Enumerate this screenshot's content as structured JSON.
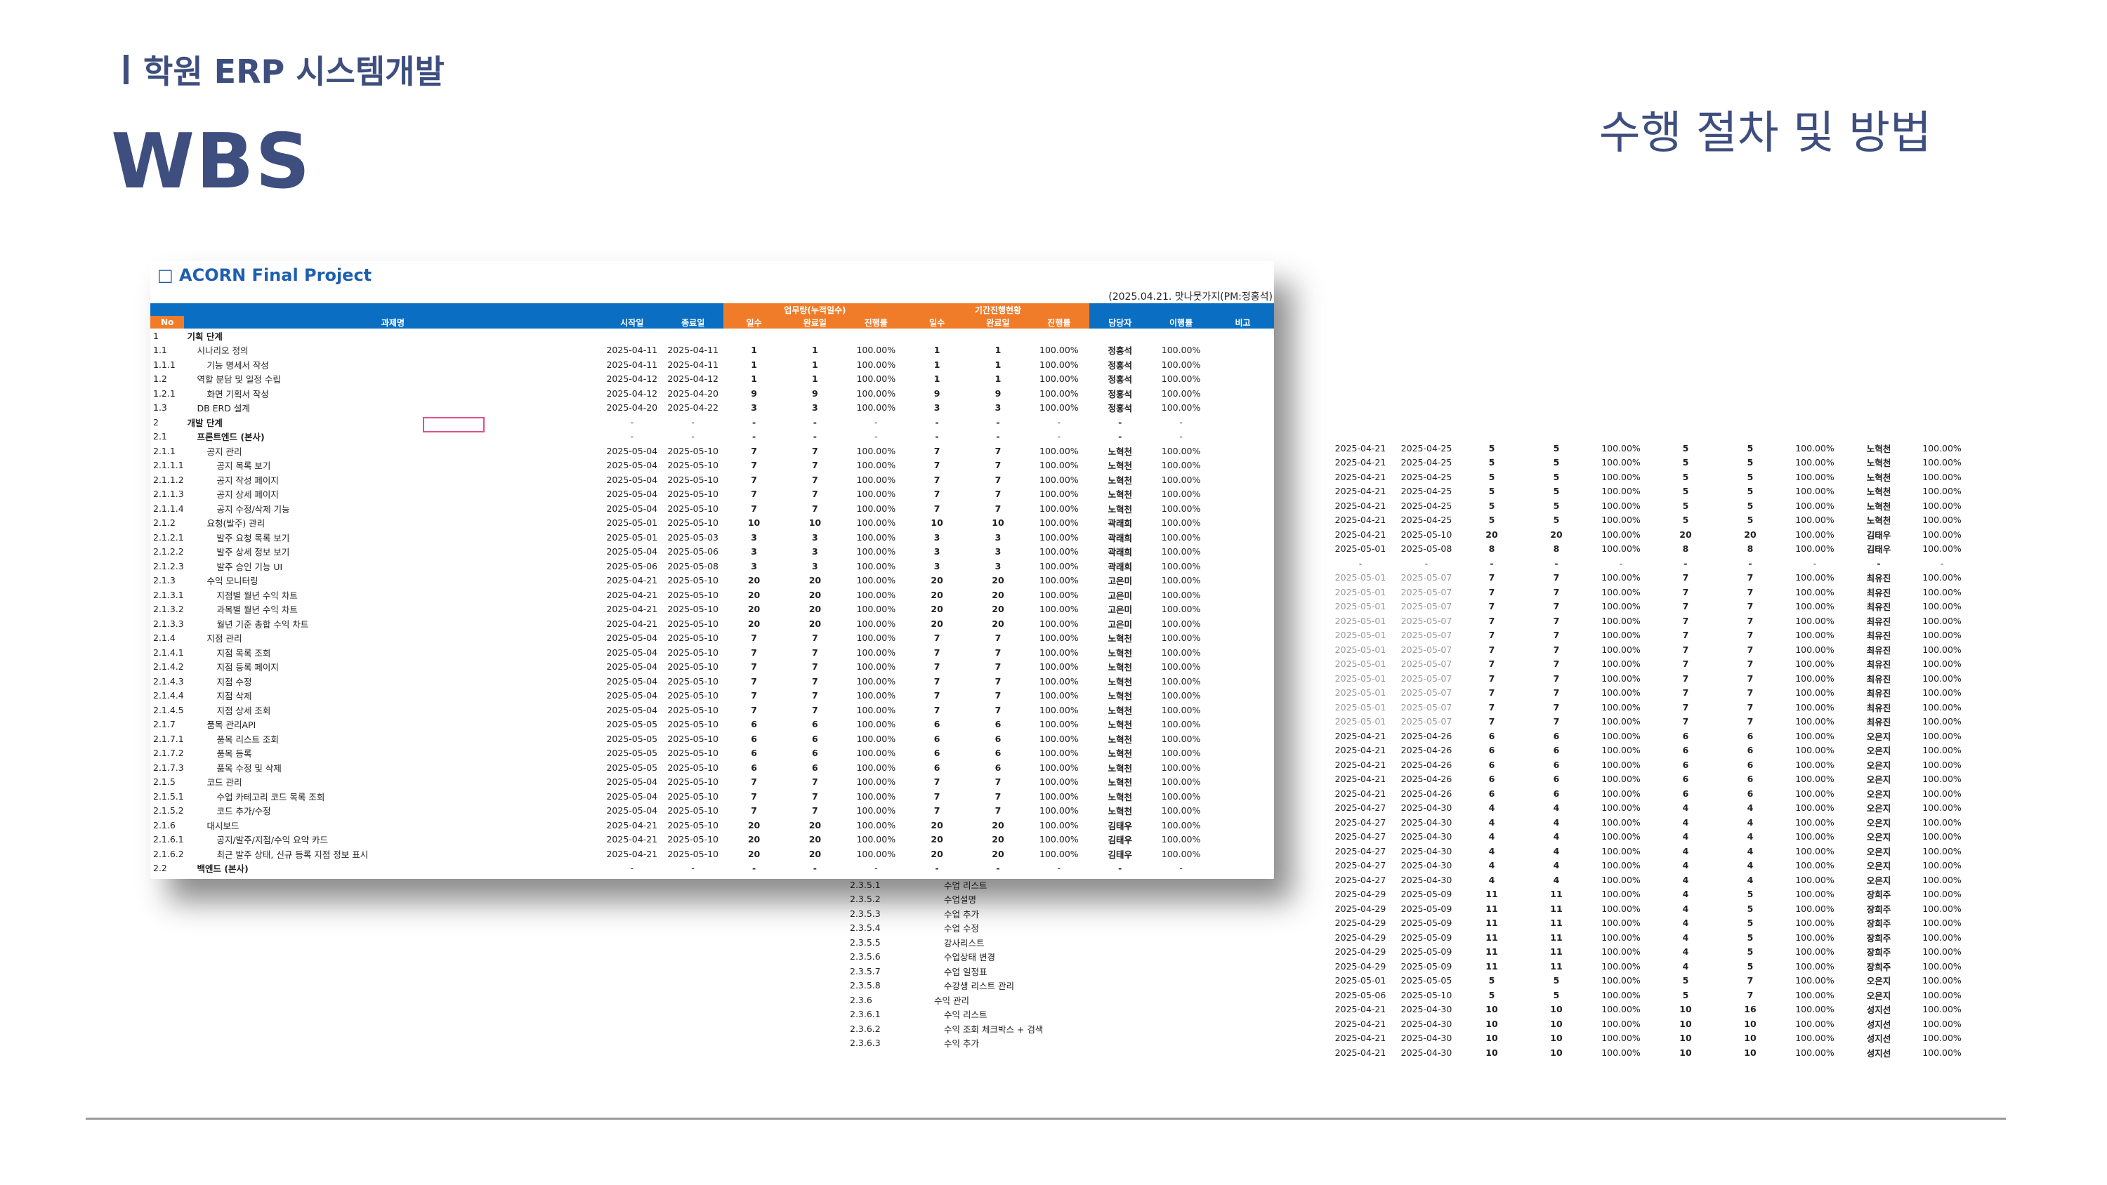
{
  "header": {
    "subtitle": "학원 ERP 시스템개발",
    "title": "WBS",
    "section": "수행 절차 및 방법"
  },
  "sheet": {
    "project_title": "ACORN Final Project",
    "note": "(2025.04.21. 맛나뭇가지(PM:정홍석)",
    "group_headers": {
      "work": "업무량(누적일수)",
      "period": "기간진행현황"
    },
    "columns": [
      "No",
      "과제명",
      "시작일",
      "종료일",
      "일수",
      "완료일",
      "진행률",
      "일수",
      "완료일",
      "진행률",
      "담당자",
      "이행률",
      "비고"
    ],
    "rows": [
      [
        "1",
        "기획 단계",
        "",
        "",
        "",
        "",
        "",
        "",
        "",
        "",
        "",
        "",
        ""
      ],
      [
        "1.1",
        "시나리오 정의",
        "2025-04-11",
        "2025-04-11",
        "1",
        "1",
        "100.00%",
        "1",
        "1",
        "100.00%",
        "정홍석",
        "100.00%",
        ""
      ],
      [
        "1.1.1",
        "기능 명세서 작성",
        "2025-04-11",
        "2025-04-11",
        "1",
        "1",
        "100.00%",
        "1",
        "1",
        "100.00%",
        "정홍석",
        "100.00%",
        ""
      ],
      [
        "1.2",
        "역할 분담 및 일정 수립",
        "2025-04-12",
        "2025-04-12",
        "1",
        "1",
        "100.00%",
        "1",
        "1",
        "100.00%",
        "정홍석",
        "100.00%",
        ""
      ],
      [
        "1.2.1",
        "화면 기획서 작성",
        "2025-04-12",
        "2025-04-20",
        "9",
        "9",
        "100.00%",
        "9",
        "9",
        "100.00%",
        "정홍석",
        "100.00%",
        ""
      ],
      [
        "1.3",
        "DB ERD 설계",
        "2025-04-20",
        "2025-04-22",
        "3",
        "3",
        "100.00%",
        "3",
        "3",
        "100.00%",
        "정홍석",
        "100.00%",
        ""
      ],
      [
        "2",
        "개발 단계",
        "-",
        "-",
        "-",
        "-",
        "-",
        "-",
        "-",
        "-",
        "-",
        "-",
        ""
      ],
      [
        "2.1",
        "프론트엔드 (본사)",
        "-",
        "-",
        "-",
        "-",
        "-",
        "-",
        "-",
        "-",
        "-",
        "-",
        ""
      ],
      [
        "2.1.1",
        "공지 관리",
        "2025-05-04",
        "2025-05-10",
        "7",
        "7",
        "100.00%",
        "7",
        "7",
        "100.00%",
        "노혁천",
        "100.00%",
        ""
      ],
      [
        "2.1.1.1",
        "공지 목록 보기",
        "2025-05-04",
        "2025-05-10",
        "7",
        "7",
        "100.00%",
        "7",
        "7",
        "100.00%",
        "노혁천",
        "100.00%",
        ""
      ],
      [
        "2.1.1.2",
        "공지 작성 페이지",
        "2025-05-04",
        "2025-05-10",
        "7",
        "7",
        "100.00%",
        "7",
        "7",
        "100.00%",
        "노혁천",
        "100.00%",
        ""
      ],
      [
        "2.1.1.3",
        "공지 상세 페이지",
        "2025-05-04",
        "2025-05-10",
        "7",
        "7",
        "100.00%",
        "7",
        "7",
        "100.00%",
        "노혁천",
        "100.00%",
        ""
      ],
      [
        "2.1.1.4",
        "공지 수정/삭제 기능",
        "2025-05-04",
        "2025-05-10",
        "7",
        "7",
        "100.00%",
        "7",
        "7",
        "100.00%",
        "노혁천",
        "100.00%",
        ""
      ],
      [
        "2.1.2",
        "요청(발주) 관리",
        "2025-05-01",
        "2025-05-10",
        "10",
        "10",
        "100.00%",
        "10",
        "10",
        "100.00%",
        "곽래희",
        "100.00%",
        ""
      ],
      [
        "2.1.2.1",
        "발주 요청 목록 보기",
        "2025-05-01",
        "2025-05-03",
        "3",
        "3",
        "100.00%",
        "3",
        "3",
        "100.00%",
        "곽래희",
        "100.00%",
        ""
      ],
      [
        "2.1.2.2",
        "발주 상세 정보 보기",
        "2025-05-04",
        "2025-05-06",
        "3",
        "3",
        "100.00%",
        "3",
        "3",
        "100.00%",
        "곽래희",
        "100.00%",
        ""
      ],
      [
        "2.1.2.3",
        "발주 승인 기능 UI",
        "2025-05-06",
        "2025-05-08",
        "3",
        "3",
        "100.00%",
        "3",
        "3",
        "100.00%",
        "곽래희",
        "100.00%",
        ""
      ],
      [
        "2.1.3",
        "수익 모니터링",
        "2025-04-21",
        "2025-05-10",
        "20",
        "20",
        "100.00%",
        "20",
        "20",
        "100.00%",
        "고은미",
        "100.00%",
        ""
      ],
      [
        "2.1.3.1",
        "지점별 월년 수익 차트",
        "2025-04-21",
        "2025-05-10",
        "20",
        "20",
        "100.00%",
        "20",
        "20",
        "100.00%",
        "고은미",
        "100.00%",
        ""
      ],
      [
        "2.1.3.2",
        "과목별 월년 수익 차트",
        "2025-04-21",
        "2025-05-10",
        "20",
        "20",
        "100.00%",
        "20",
        "20",
        "100.00%",
        "고은미",
        "100.00%",
        ""
      ],
      [
        "2.1.3.3",
        "월년 기준 총합 수익 차트",
        "2025-04-21",
        "2025-05-10",
        "20",
        "20",
        "100.00%",
        "20",
        "20",
        "100.00%",
        "고은미",
        "100.00%",
        ""
      ],
      [
        "2.1.4",
        "지점 관리",
        "2025-05-04",
        "2025-05-10",
        "7",
        "7",
        "100.00%",
        "7",
        "7",
        "100.00%",
        "노혁천",
        "100.00%",
        ""
      ],
      [
        "2.1.4.1",
        "지점 목록 조회",
        "2025-05-04",
        "2025-05-10",
        "7",
        "7",
        "100.00%",
        "7",
        "7",
        "100.00%",
        "노혁천",
        "100.00%",
        ""
      ],
      [
        "2.1.4.2",
        "지점 등록 페이지",
        "2025-05-04",
        "2025-05-10",
        "7",
        "7",
        "100.00%",
        "7",
        "7",
        "100.00%",
        "노혁천",
        "100.00%",
        ""
      ],
      [
        "2.1.4.3",
        "지점 수정",
        "2025-05-04",
        "2025-05-10",
        "7",
        "7",
        "100.00%",
        "7",
        "7",
        "100.00%",
        "노혁천",
        "100.00%",
        ""
      ],
      [
        "2.1.4.4",
        "지점 삭제",
        "2025-05-04",
        "2025-05-10",
        "7",
        "7",
        "100.00%",
        "7",
        "7",
        "100.00%",
        "노혁천",
        "100.00%",
        ""
      ],
      [
        "2.1.4.5",
        "지점 상세 조회",
        "2025-05-04",
        "2025-05-10",
        "7",
        "7",
        "100.00%",
        "7",
        "7",
        "100.00%",
        "노혁천",
        "100.00%",
        ""
      ],
      [
        "2.1.7",
        "품목 관리API",
        "2025-05-05",
        "2025-05-10",
        "6",
        "6",
        "100.00%",
        "6",
        "6",
        "100.00%",
        "노혁천",
        "100.00%",
        ""
      ],
      [
        "2.1.7.1",
        "품목 리스트 조회",
        "2025-05-05",
        "2025-05-10",
        "6",
        "6",
        "100.00%",
        "6",
        "6",
        "100.00%",
        "노혁천",
        "100.00%",
        ""
      ],
      [
        "2.1.7.2",
        "품목 등록",
        "2025-05-05",
        "2025-05-10",
        "6",
        "6",
        "100.00%",
        "6",
        "6",
        "100.00%",
        "노혁천",
        "100.00%",
        ""
      ],
      [
        "2.1.7.3",
        "품목 수정 및 삭제",
        "2025-05-05",
        "2025-05-10",
        "6",
        "6",
        "100.00%",
        "6",
        "6",
        "100.00%",
        "노혁천",
        "100.00%",
        ""
      ],
      [
        "2.1.5",
        "코드 관리",
        "2025-05-04",
        "2025-05-10",
        "7",
        "7",
        "100.00%",
        "7",
        "7",
        "100.00%",
        "노혁천",
        "100.00%",
        ""
      ],
      [
        "2.1.5.1",
        "수업 카테고리 코드 목록 조회",
        "2025-05-04",
        "2025-05-10",
        "7",
        "7",
        "100.00%",
        "7",
        "7",
        "100.00%",
        "노혁천",
        "100.00%",
        ""
      ],
      [
        "2.1.5.2",
        "코드 추가/수정",
        "2025-05-04",
        "2025-05-10",
        "7",
        "7",
        "100.00%",
        "7",
        "7",
        "100.00%",
        "노혁천",
        "100.00%",
        ""
      ],
      [
        "2.1.6",
        "대시보드",
        "2025-04-21",
        "2025-05-10",
        "20",
        "20",
        "100.00%",
        "20",
        "20",
        "100.00%",
        "김태우",
        "100.00%",
        ""
      ],
      [
        "2.1.6.1",
        "공지/발주/지점/수익 요약 카드",
        "2025-04-21",
        "2025-05-10",
        "20",
        "20",
        "100.00%",
        "20",
        "20",
        "100.00%",
        "김태우",
        "100.00%",
        ""
      ],
      [
        "2.1.6.2",
        "최근 발주 상태, 신규 등록 지점 정보 표시",
        "2025-04-21",
        "2025-05-10",
        "20",
        "20",
        "100.00%",
        "20",
        "20",
        "100.00%",
        "김태우",
        "100.00%",
        ""
      ],
      [
        "2.2",
        "백엔드 (본사)",
        "-",
        "-",
        "-",
        "-",
        "-",
        "-",
        "-",
        "-",
        "-",
        "-",
        ""
      ]
    ]
  },
  "sheet2": {
    "rows": [
      [
        "2.3.5.1",
        "수업 리스트"
      ],
      [
        "2.3.5.2",
        "수업설명"
      ],
      [
        "2.3.5.3",
        "수업 추가"
      ],
      [
        "2.3.5.4",
        "수업 수정"
      ],
      [
        "2.3.5.5",
        "강사리스트"
      ],
      [
        "2.3.5.6",
        "수업상태 변경"
      ],
      [
        "2.3.5.7",
        "수업 일정표"
      ],
      [
        "2.3.5.8",
        "수강생 리스트 관리"
      ],
      [
        "2.3.6",
        "수익 관리"
      ],
      [
        "2.3.6.1",
        "수익 리스트"
      ],
      [
        "2.3.6.2",
        "수익 조회 체크박스 + 검색"
      ],
      [
        "2.3.6.3",
        "수익 추가"
      ]
    ]
  },
  "sheet3": {
    "rows": [
      [
        "2025-04-21",
        "2025-04-25",
        "5",
        "5",
        "100.00%",
        "5",
        "5",
        "100.00%",
        "노혁천",
        "100.00%"
      ],
      [
        "2025-04-21",
        "2025-04-25",
        "5",
        "5",
        "100.00%",
        "5",
        "5",
        "100.00%",
        "노혁천",
        "100.00%"
      ],
      [
        "2025-04-21",
        "2025-04-25",
        "5",
        "5",
        "100.00%",
        "5",
        "5",
        "100.00%",
        "노혁천",
        "100.00%"
      ],
      [
        "2025-04-21",
        "2025-04-25",
        "5",
        "5",
        "100.00%",
        "5",
        "5",
        "100.00%",
        "노혁천",
        "100.00%"
      ],
      [
        "2025-04-21",
        "2025-04-25",
        "5",
        "5",
        "100.00%",
        "5",
        "5",
        "100.00%",
        "노혁천",
        "100.00%"
      ],
      [
        "2025-04-21",
        "2025-04-25",
        "5",
        "5",
        "100.00%",
        "5",
        "5",
        "100.00%",
        "노혁천",
        "100.00%"
      ],
      [
        "2025-04-21",
        "2025-05-10",
        "20",
        "20",
        "100.00%",
        "20",
        "20",
        "100.00%",
        "김태우",
        "100.00%"
      ],
      [
        "2025-05-01",
        "2025-05-08",
        "8",
        "8",
        "100.00%",
        "8",
        "8",
        "100.00%",
        "김태우",
        "100.00%"
      ],
      [
        "-",
        "-",
        "-",
        "-",
        "-",
        "-",
        "-",
        "-",
        "-",
        "-"
      ],
      [
        "2025-05-01",
        "2025-05-07",
        "7",
        "7",
        "100.00%",
        "7",
        "7",
        "100.00%",
        "최유진",
        "100.00%"
      ],
      [
        "2025-05-01",
        "2025-05-07",
        "7",
        "7",
        "100.00%",
        "7",
        "7",
        "100.00%",
        "최유진",
        "100.00%"
      ],
      [
        "2025-05-01",
        "2025-05-07",
        "7",
        "7",
        "100.00%",
        "7",
        "7",
        "100.00%",
        "최유진",
        "100.00%"
      ],
      [
        "2025-05-01",
        "2025-05-07",
        "7",
        "7",
        "100.00%",
        "7",
        "7",
        "100.00%",
        "최유진",
        "100.00%"
      ],
      [
        "2025-05-01",
        "2025-05-07",
        "7",
        "7",
        "100.00%",
        "7",
        "7",
        "100.00%",
        "최유진",
        "100.00%"
      ],
      [
        "2025-05-01",
        "2025-05-07",
        "7",
        "7",
        "100.00%",
        "7",
        "7",
        "100.00%",
        "최유진",
        "100.00%"
      ],
      [
        "2025-05-01",
        "2025-05-07",
        "7",
        "7",
        "100.00%",
        "7",
        "7",
        "100.00%",
        "최유진",
        "100.00%"
      ],
      [
        "2025-05-01",
        "2025-05-07",
        "7",
        "7",
        "100.00%",
        "7",
        "7",
        "100.00%",
        "최유진",
        "100.00%"
      ],
      [
        "2025-05-01",
        "2025-05-07",
        "7",
        "7",
        "100.00%",
        "7",
        "7",
        "100.00%",
        "최유진",
        "100.00%"
      ],
      [
        "2025-05-01",
        "2025-05-07",
        "7",
        "7",
        "100.00%",
        "7",
        "7",
        "100.00%",
        "최유진",
        "100.00%"
      ],
      [
        "2025-05-01",
        "2025-05-07",
        "7",
        "7",
        "100.00%",
        "7",
        "7",
        "100.00%",
        "최유진",
        "100.00%"
      ],
      [
        "2025-04-21",
        "2025-04-26",
        "6",
        "6",
        "100.00%",
        "6",
        "6",
        "100.00%",
        "오은지",
        "100.00%"
      ],
      [
        "2025-04-21",
        "2025-04-26",
        "6",
        "6",
        "100.00%",
        "6",
        "6",
        "100.00%",
        "오은지",
        "100.00%"
      ],
      [
        "2025-04-21",
        "2025-04-26",
        "6",
        "6",
        "100.00%",
        "6",
        "6",
        "100.00%",
        "오은지",
        "100.00%"
      ],
      [
        "2025-04-21",
        "2025-04-26",
        "6",
        "6",
        "100.00%",
        "6",
        "6",
        "100.00%",
        "오은지",
        "100.00%"
      ],
      [
        "2025-04-21",
        "2025-04-26",
        "6",
        "6",
        "100.00%",
        "6",
        "6",
        "100.00%",
        "오은지",
        "100.00%"
      ],
      [
        "2025-04-27",
        "2025-04-30",
        "4",
        "4",
        "100.00%",
        "4",
        "4",
        "100.00%",
        "오은지",
        "100.00%"
      ],
      [
        "2025-04-27",
        "2025-04-30",
        "4",
        "4",
        "100.00%",
        "4",
        "4",
        "100.00%",
        "오은지",
        "100.00%"
      ],
      [
        "2025-04-27",
        "2025-04-30",
        "4",
        "4",
        "100.00%",
        "4",
        "4",
        "100.00%",
        "오은지",
        "100.00%"
      ],
      [
        "2025-04-27",
        "2025-04-30",
        "4",
        "4",
        "100.00%",
        "4",
        "4",
        "100.00%",
        "오은지",
        "100.00%"
      ],
      [
        "2025-04-27",
        "2025-04-30",
        "4",
        "4",
        "100.00%",
        "4",
        "4",
        "100.00%",
        "오은지",
        "100.00%"
      ],
      [
        "2025-04-27",
        "2025-04-30",
        "4",
        "4",
        "100.00%",
        "4",
        "4",
        "100.00%",
        "오은지",
        "100.00%"
      ],
      [
        "2025-04-29",
        "2025-05-09",
        "11",
        "11",
        "100.00%",
        "4",
        "5",
        "100.00%",
        "장희주",
        "100.00%"
      ],
      [
        "2025-04-29",
        "2025-05-09",
        "11",
        "11",
        "100.00%",
        "4",
        "5",
        "100.00%",
        "장희주",
        "100.00%"
      ],
      [
        "2025-04-29",
        "2025-05-09",
        "11",
        "11",
        "100.00%",
        "4",
        "5",
        "100.00%",
        "장희주",
        "100.00%"
      ],
      [
        "2025-04-29",
        "2025-05-09",
        "11",
        "11",
        "100.00%",
        "4",
        "5",
        "100.00%",
        "장희주",
        "100.00%"
      ],
      [
        "2025-04-29",
        "2025-05-09",
        "11",
        "11",
        "100.00%",
        "4",
        "5",
        "100.00%",
        "장희주",
        "100.00%"
      ],
      [
        "2025-04-29",
        "2025-05-09",
        "11",
        "11",
        "100.00%",
        "4",
        "5",
        "100.00%",
        "장희주",
        "100.00%"
      ],
      [
        "2025-05-01",
        "2025-05-05",
        "5",
        "5",
        "100.00%",
        "5",
        "7",
        "100.00%",
        "오은지",
        "100.00%"
      ],
      [
        "2025-05-06",
        "2025-05-10",
        "5",
        "5",
        "100.00%",
        "5",
        "7",
        "100.00%",
        "오은지",
        "100.00%"
      ],
      [
        "2025-04-21",
        "2025-04-30",
        "10",
        "10",
        "100.00%",
        "10",
        "16",
        "100.00%",
        "성지선",
        "100.00%"
      ],
      [
        "2025-04-21",
        "2025-04-30",
        "10",
        "10",
        "100.00%",
        "10",
        "10",
        "100.00%",
        "성지선",
        "100.00%"
      ],
      [
        "2025-04-21",
        "2025-04-30",
        "10",
        "10",
        "100.00%",
        "10",
        "10",
        "100.00%",
        "성지선",
        "100.00%"
      ],
      [
        "2025-04-21",
        "2025-04-30",
        "10",
        "10",
        "100.00%",
        "10",
        "10",
        "100.00%",
        "성지선",
        "100.00%"
      ]
    ]
  }
}
